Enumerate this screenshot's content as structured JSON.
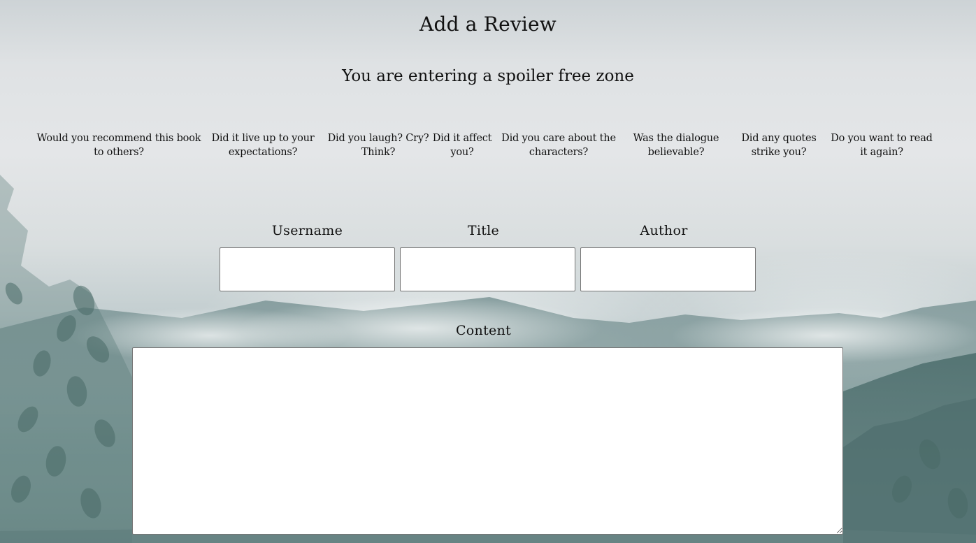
{
  "page": {
    "title": "Add a Review",
    "subtitle": "You are entering a spoiler free zone"
  },
  "questions": [
    {
      "line1": "Would you recommend this book",
      "line2": "to others?"
    },
    {
      "line1": "Did it live up to your",
      "line2": "expectations?"
    },
    {
      "line1": "Did you laugh? Cry?",
      "line2": "Think?"
    },
    {
      "line1": "Did it affect",
      "line2": "you?"
    },
    {
      "line1": "Did you care about the",
      "line2": "characters?"
    },
    {
      "line1": "Was the dialogue",
      "line2": "believable?"
    },
    {
      "line1": "Did any quotes",
      "line2": "strike you?"
    },
    {
      "line1": "Do you want to read",
      "line2": "it again?"
    }
  ],
  "form": {
    "username": {
      "label": "Username",
      "value": ""
    },
    "title": {
      "label": "Title",
      "value": ""
    },
    "author": {
      "label": "Author",
      "value": ""
    },
    "content": {
      "label": "Content",
      "value": ""
    }
  },
  "colors": {
    "text": "#111111",
    "field_background": "#ffffff",
    "field_border": "#767676"
  }
}
